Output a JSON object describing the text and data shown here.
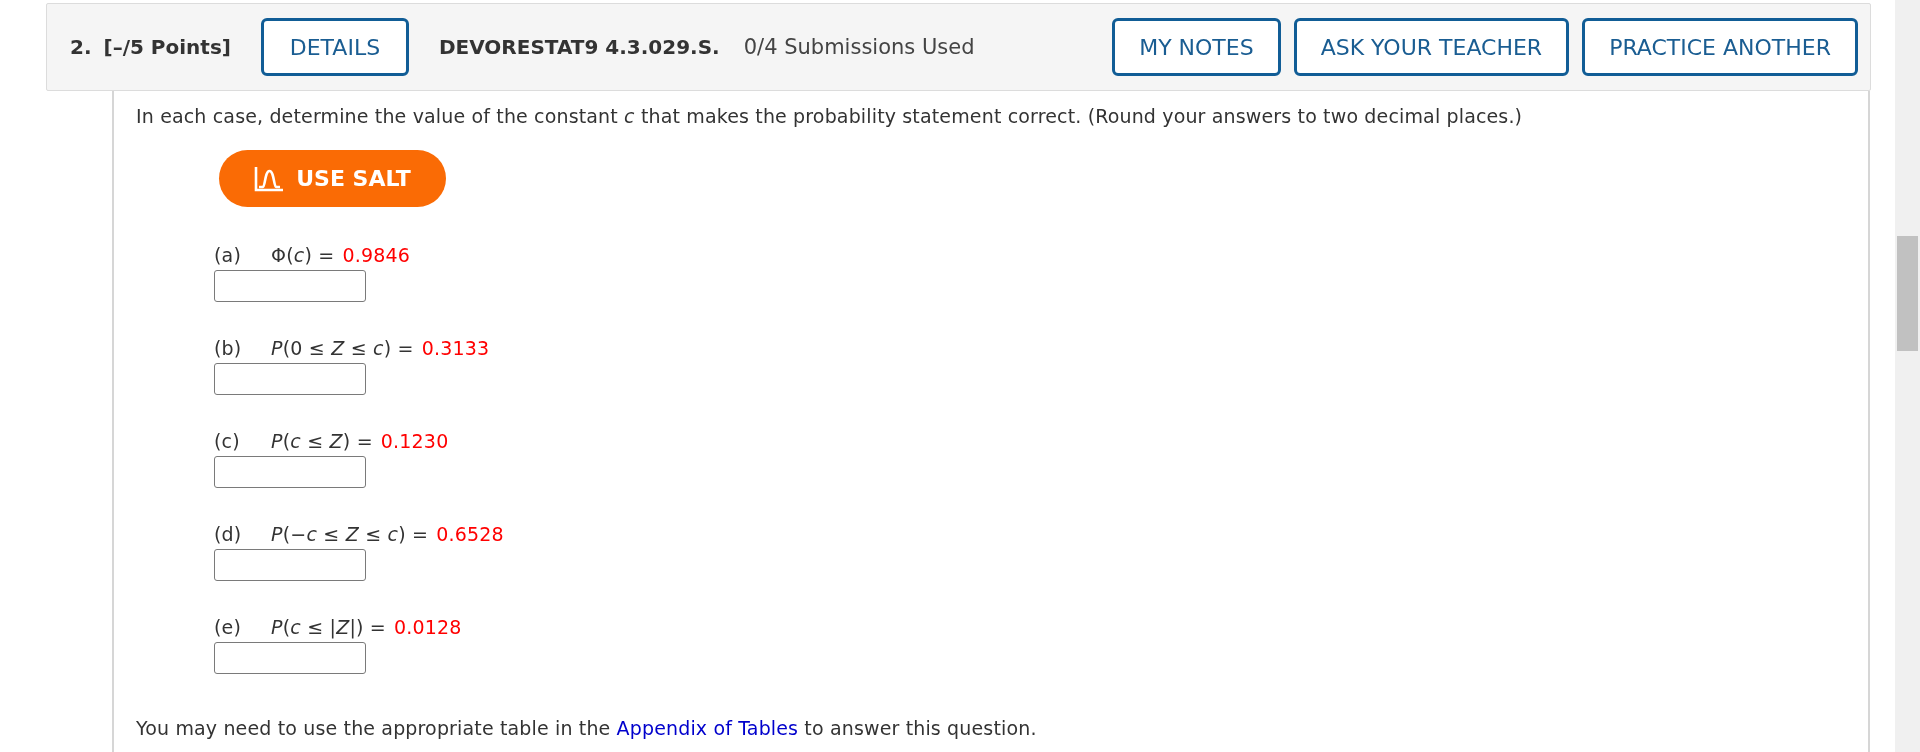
{
  "question": {
    "number": "2.",
    "points": "[–/5 Points]",
    "details_button": "DETAILS",
    "code": "DEVORESTAT9 4.3.029.S.",
    "submissions": "0/4 Submissions Used",
    "actions": [
      "MY NOTES",
      "ASK YOUR TEACHER",
      "PRACTICE ANOTHER"
    ]
  },
  "instructions": "In each case, determine the value of the constant *c* that makes the probability statement correct. (Round your answers to two decimal places.)",
  "salt_button": "USE SALT",
  "parts": [
    {
      "label": "(a)",
      "expression": "Φ(*c*) =",
      "value": "0.9846"
    },
    {
      "label": "(b)",
      "expression": "*P*(0 ≤ *Z* ≤ *c*) =",
      "value": "0.3133"
    },
    {
      "label": "(c)",
      "expression": "*P*(*c* ≤ *Z*) =",
      "value": "0.1230"
    },
    {
      "label": "(d)",
      "expression": "*P*(−*c* ≤ *Z* ≤ *c*) =",
      "value": "0.6528"
    },
    {
      "label": "(e)",
      "expression": "*P*(*c* ≤ |*Z*|) =",
      "value": "0.0128"
    }
  ],
  "footer": {
    "text_before": "You may need to use the appropriate table in the ",
    "link": "Appendix of Tables",
    "text_after": " to answer this question."
  }
}
